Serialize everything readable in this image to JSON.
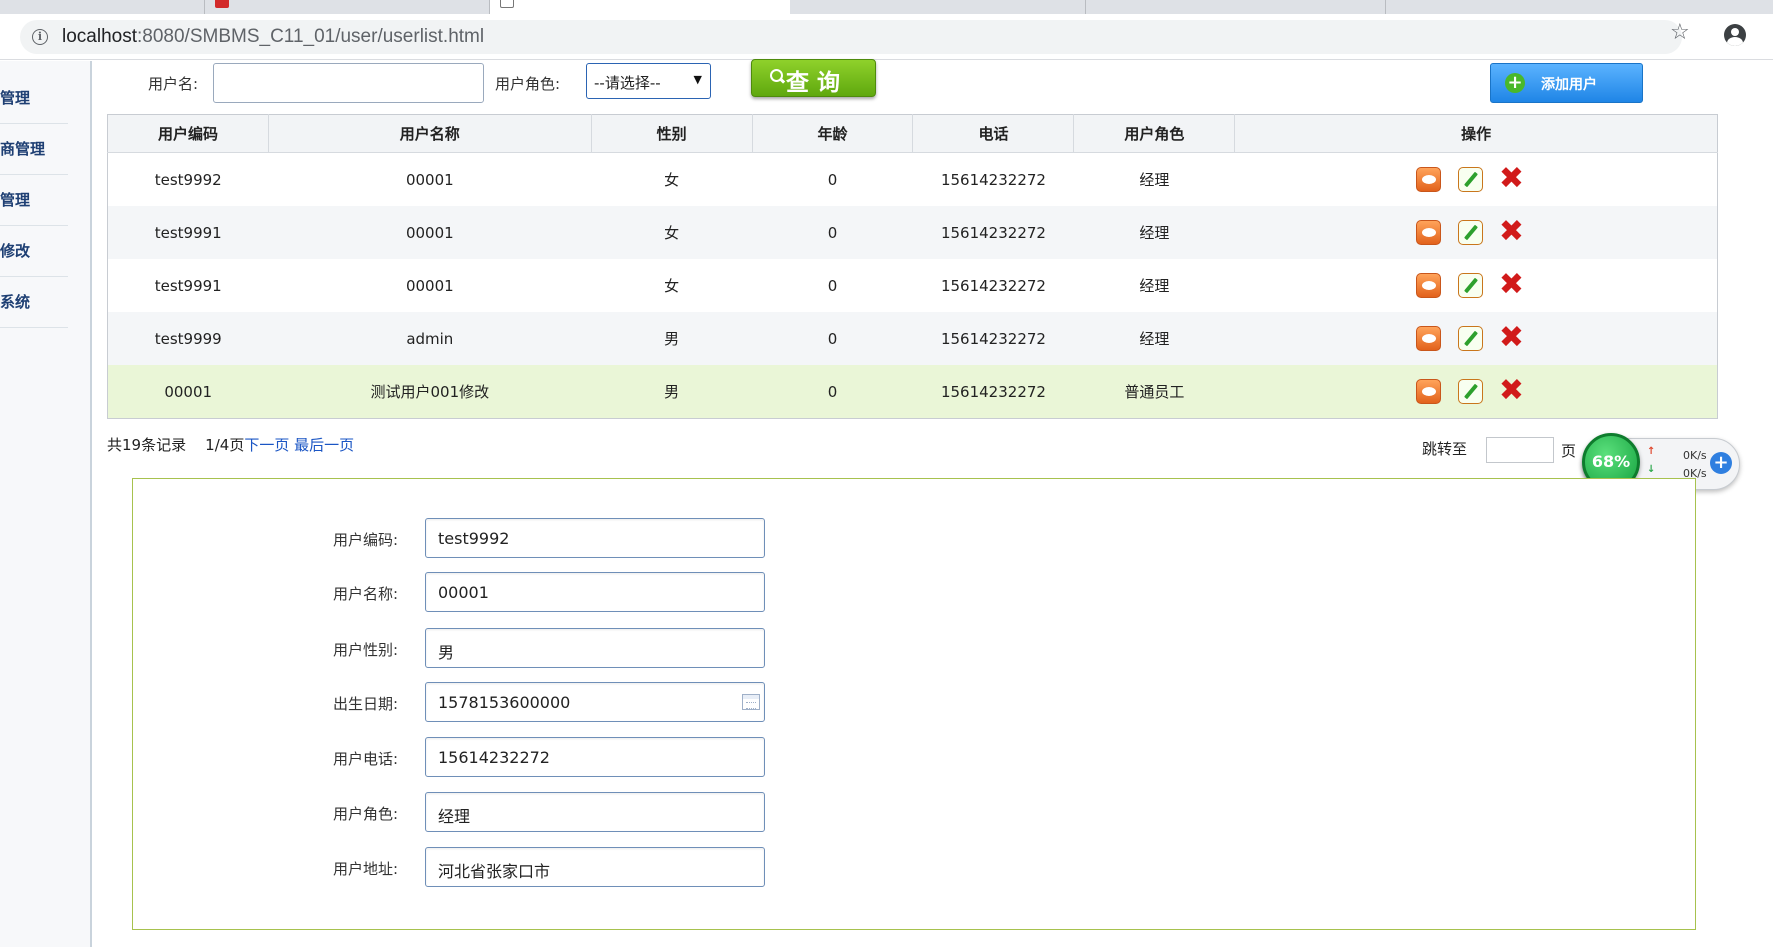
{
  "browser": {
    "url_host": "localhost",
    "url_path": ":8080/SMBMS_C11_01/user/userlist.html"
  },
  "sidebar": {
    "items": [
      {
        "label": "管理"
      },
      {
        "label": "商管理"
      },
      {
        "label": "管理"
      },
      {
        "label": "修改"
      },
      {
        "label": "系统"
      }
    ]
  },
  "search": {
    "username_label": "用户名:",
    "role_label": "用户角色:",
    "role_selected": "--请选择--",
    "query_label": "查 询",
    "add_user_label": "添加用户"
  },
  "table": {
    "headers": [
      "用户编码",
      "用户名称",
      "性别",
      "年龄",
      "电话",
      "用户角色",
      "操作"
    ],
    "rows": [
      {
        "code": "test9992",
        "name": "00001",
        "gender": "女",
        "age": "0",
        "phone": "15614232272",
        "role": "经理"
      },
      {
        "code": "test9991",
        "name": "00001",
        "gender": "女",
        "age": "0",
        "phone": "15614232272",
        "role": "经理"
      },
      {
        "code": "test9991",
        "name": "00001",
        "gender": "女",
        "age": "0",
        "phone": "15614232272",
        "role": "经理"
      },
      {
        "code": "test9999",
        "name": "admin",
        "gender": "男",
        "age": "0",
        "phone": "15614232272",
        "role": "经理"
      },
      {
        "code": "00001",
        "name": "测试用户001修改",
        "gender": "男",
        "age": "0",
        "phone": "15614232272",
        "role": "普通员工"
      }
    ]
  },
  "pager": {
    "summary": "共19条记录",
    "page_info": "1/4页",
    "next_link": "下一页",
    "last_link": "最后一页",
    "jump_label": "跳转至",
    "page_unit": "页"
  },
  "net_widget": {
    "percent": "68%",
    "up_rate": "0K/s",
    "down_rate": "0K/s"
  },
  "detail": {
    "fields": [
      {
        "label": "用户编码:",
        "value": "test9992"
      },
      {
        "label": "用户名称:",
        "value": "00001"
      },
      {
        "label": "用户性别:",
        "value": "男"
      },
      {
        "label": "出生日期:",
        "value": "1578153600000"
      },
      {
        "label": "用户电话:",
        "value": "15614232272"
      },
      {
        "label": "用户角色:",
        "value": "经理"
      },
      {
        "label": "用户地址:",
        "value": "河北省张家口市"
      }
    ]
  },
  "colors": {
    "accent_green": "#5fa80e",
    "accent_blue": "#1f85e6",
    "panel_border": "#a7c24e",
    "highlight_row": "#eaf6d7",
    "sidebar_text": "#1e3f73",
    "delete_red": "#d11a1a"
  }
}
